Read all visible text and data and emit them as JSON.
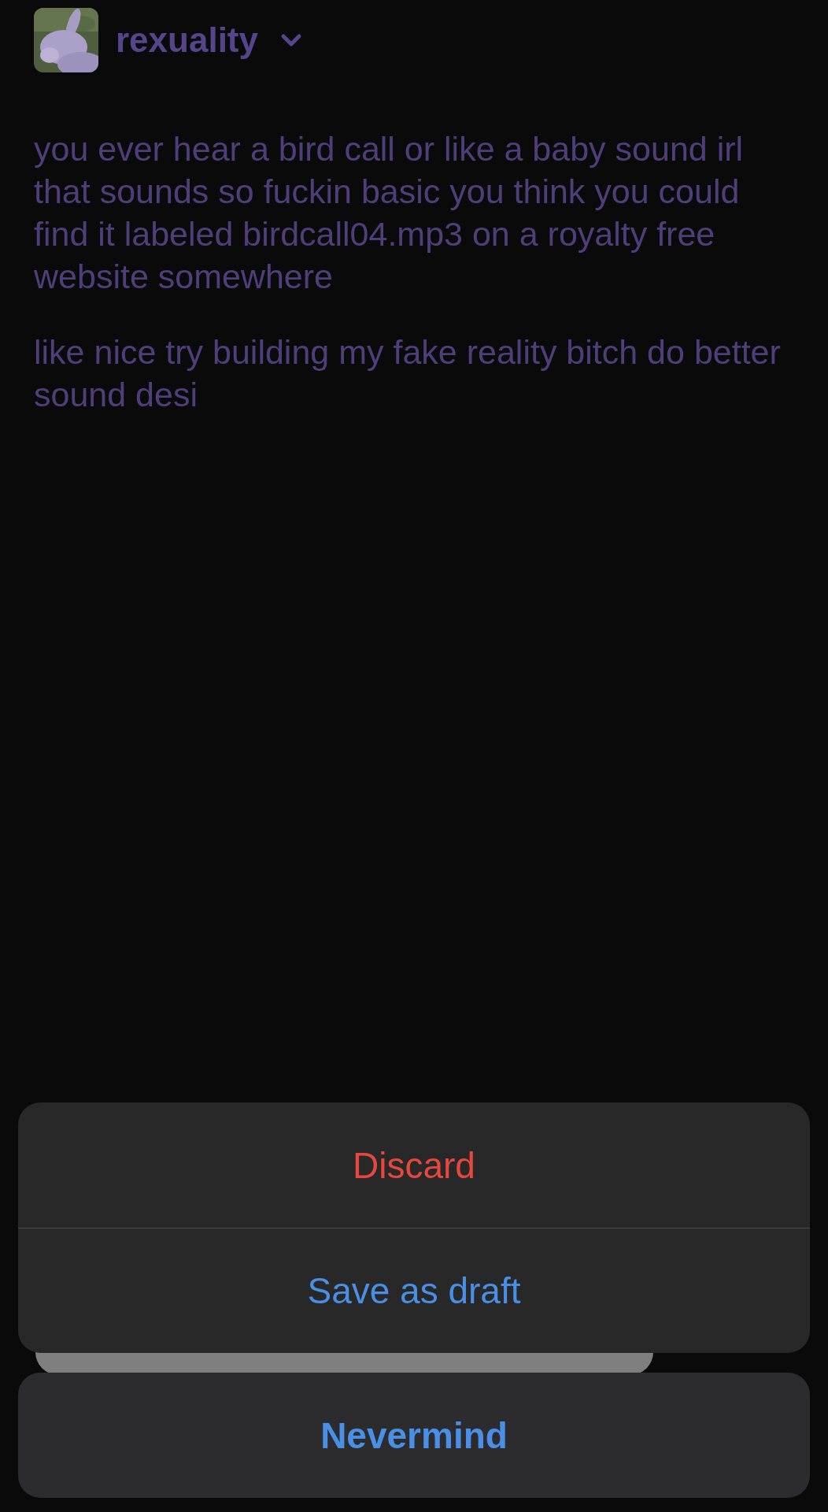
{
  "account": {
    "username": "rexuality"
  },
  "post": {
    "paragraphs": [
      "you ever hear a bird call or like a baby sound irl that sounds so fuckin basic you think you could find it labeled birdcall04.mp3 on a royalty free website somewhere",
      "like nice try building my fake reality bitch do better sound desi"
    ]
  },
  "action_sheet": {
    "actions": [
      {
        "label": "Discard",
        "kind": "destructive"
      },
      {
        "label": "Save as draft",
        "kind": "default"
      }
    ],
    "cancel": {
      "label": "Nevermind"
    }
  }
}
